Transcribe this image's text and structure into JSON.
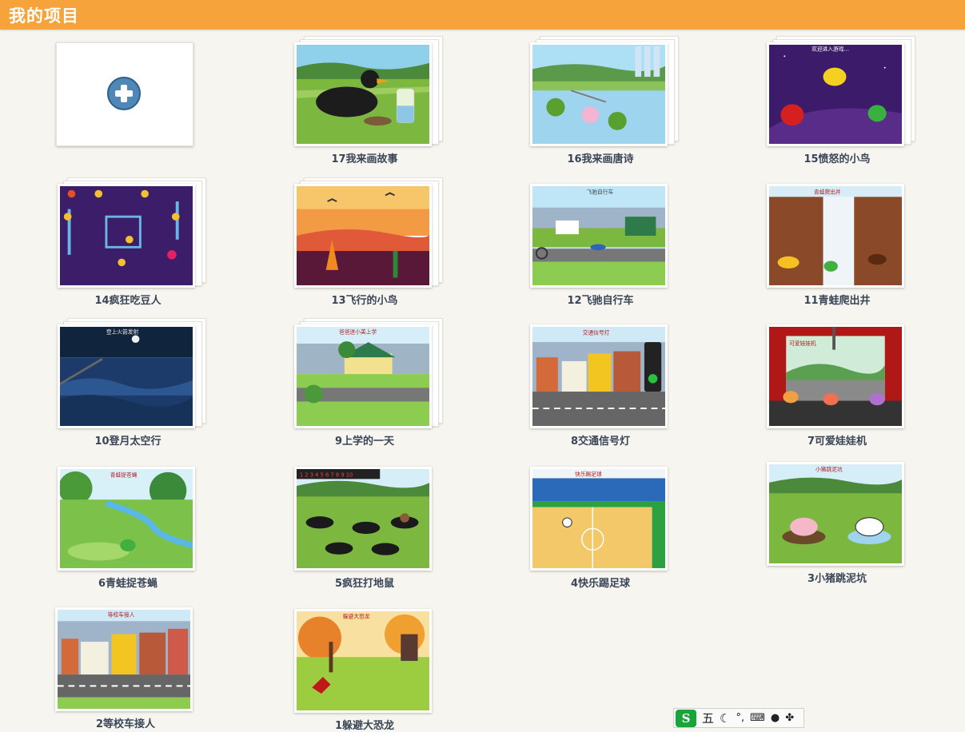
{
  "header": {
    "title": "我的项目"
  },
  "projects": [
    {
      "title": "17我来画故事",
      "scene_title": ""
    },
    {
      "title": "16我来画唐诗",
      "scene_title": ""
    },
    {
      "title": "15愤怒的小鸟",
      "scene_title": "欢迎进入游戏..."
    },
    {
      "title": "14疯狂吃豆人",
      "scene_title": ""
    },
    {
      "title": "13飞行的小鸟",
      "scene_title": ""
    },
    {
      "title": "12飞驰自行车",
      "scene_title": "飞驰自行车"
    },
    {
      "title": "11青蛙爬出井",
      "scene_title": "青蛙爬出井"
    },
    {
      "title": "10登月太空行",
      "scene_title": "登上火箭发射"
    },
    {
      "title": "9上学的一天",
      "scene_title": "爸爸送小美上学"
    },
    {
      "title": "8交通信号灯",
      "scene_title": "交通信号灯"
    },
    {
      "title": "7可爱娃娃机",
      "scene_title": "可爱娃娃机"
    },
    {
      "title": "6青蛙捉苍蝇",
      "scene_title": "青蛙捉苍蝇"
    },
    {
      "title": "5疯狂打地鼠",
      "scene_title": "1 2 3 4 5 6 7 8 9 10"
    },
    {
      "title": "4快乐踢足球",
      "scene_title": "快乐踢足球"
    },
    {
      "title": "3小猪跳泥坑",
      "scene_title": "小猪跳泥坑"
    },
    {
      "title": "2等校车接人",
      "scene_title": "等校车接人"
    },
    {
      "title": "1躲避大恐龙",
      "scene_title": "躲避大恐龙"
    }
  ],
  "ime_toolbar": {
    "logo": "S",
    "mode": "五",
    "items": [
      "moon-icon",
      "punctuation-icon",
      "keyboard-icon",
      "user-icon",
      "grid-icon"
    ]
  }
}
